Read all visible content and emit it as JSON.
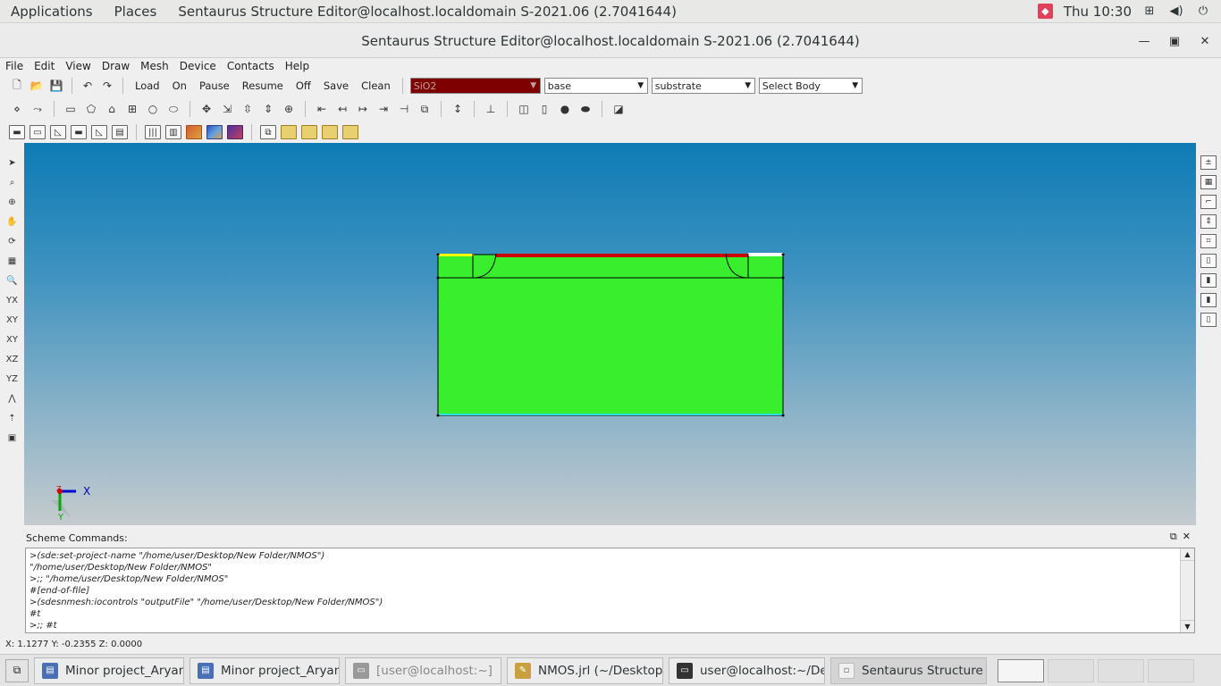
{
  "topbar": {
    "applications": "Applications",
    "places": "Places",
    "active_window": "Sentaurus Structure Editor@localhost.localdomain S-2021.06 (2.7041644)",
    "clock": "Thu 10:30"
  },
  "window": {
    "title": "Sentaurus Structure Editor@localhost.localdomain S-2021.06 (2.7041644)"
  },
  "menu": [
    "File",
    "Edit",
    "View",
    "Draw",
    "Mesh",
    "Device",
    "Contacts",
    "Help"
  ],
  "toolbar": {
    "load": "Load",
    "on": "On",
    "pause": "Pause",
    "resume": "Resume",
    "off": "Off",
    "save": "Save",
    "clean": "Clean",
    "material": "SiO2",
    "region": "base",
    "region2": "substrate",
    "body": "Select Body"
  },
  "axis": {
    "x": "X",
    "y": "Y",
    "z": "Z"
  },
  "scheme": {
    "title": "Scheme Commands:",
    "lines": [
      ">(sde:set-project-name \"/home/user/Desktop/New Folder/NMOS\")",
      "\"/home/user/Desktop/New Folder/NMOS\"",
      ">;; \"/home/user/Desktop/New Folder/NMOS\"",
      "#[end-of-file]",
      ">(sdesnmesh:iocontrols \"outputFile\" \"/home/user/Desktop/New Folder/NMOS\")",
      "#t",
      ">;; #t"
    ]
  },
  "status": "X: 1.1277 Y: -0.2355 Z: 0.0000",
  "taskbar": [
    {
      "label": "Minor project_Aryan",
      "icon": "file-manager-icon"
    },
    {
      "label": "Minor project_Aryan",
      "icon": "file-manager-icon"
    },
    {
      "label": "[user@localhost:~]",
      "icon": "terminal-icon"
    },
    {
      "label": "NMOS.jrl (~/Desktop...",
      "icon": "text-editor-icon"
    },
    {
      "label": "user@localhost:~/De...",
      "icon": "terminal-icon"
    },
    {
      "label": "Sentaurus Structure ...",
      "icon": "sde-icon"
    }
  ],
  "colors": {
    "silicon": "#39ee2c",
    "oxide": "#cc0000",
    "contact_bottom": "#28e0e0",
    "gate_strip": "#ffff00",
    "material_combo": "#7e0000"
  }
}
